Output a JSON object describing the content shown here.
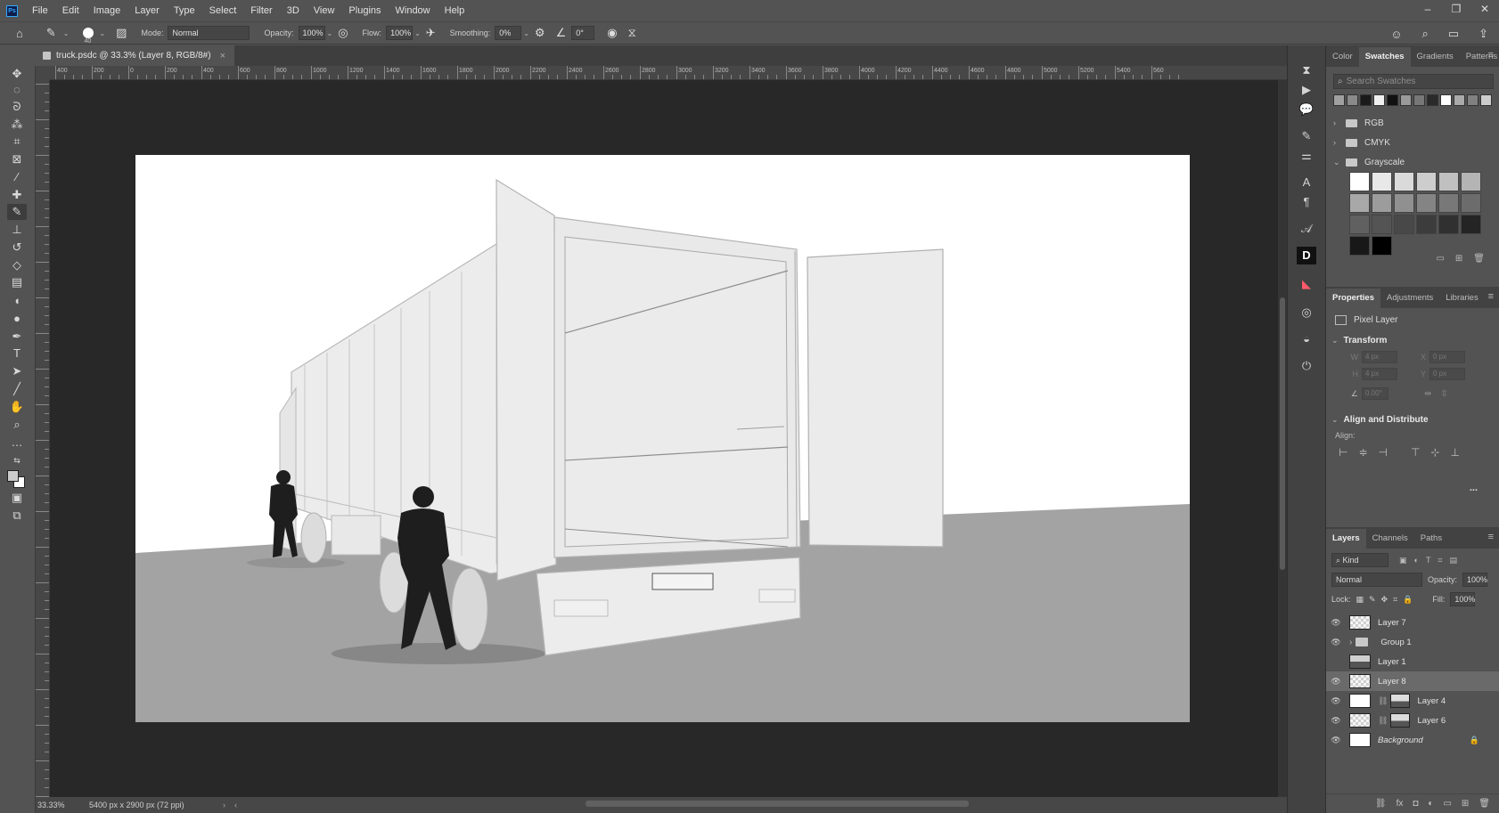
{
  "app": {
    "logo": "Ps"
  },
  "menu": [
    "File",
    "Edit",
    "Image",
    "Layer",
    "Type",
    "Select",
    "Filter",
    "3D",
    "View",
    "Plugins",
    "Window",
    "Help"
  ],
  "window_controls": {
    "minimize": "–",
    "restore": "❐",
    "close": "✕"
  },
  "options_bar": {
    "brush_size": "40",
    "mode_label": "Mode:",
    "mode_value": "Normal",
    "opacity_label": "Opacity:",
    "opacity_value": "100%",
    "flow_label": "Flow:",
    "flow_value": "100%",
    "smoothing_label": "Smoothing:",
    "smoothing_value": "0%",
    "angle_value": "0°"
  },
  "document_tab": {
    "title": "truck.psdc @ 33.3% (Layer 8, RGB/8#)",
    "close": "×"
  },
  "ruler": {
    "h_labels": [
      "400",
      "200",
      "0",
      "200",
      "400",
      "600",
      "800",
      "1000",
      "1200",
      "1400",
      "1600",
      "1800",
      "2000",
      "2200",
      "2400",
      "2600",
      "2800",
      "3000",
      "3200",
      "3400",
      "3600",
      "3800",
      "4000",
      "4200",
      "4400",
      "4600",
      "4800",
      "5000",
      "5200",
      "5400",
      "560"
    ]
  },
  "status_bar": {
    "zoom": "33.33%",
    "doc_info": "5400 px x 2900 px (72 ppi)"
  },
  "swatches_panel": {
    "tabs": [
      "Color",
      "Swatches",
      "Gradients",
      "Patterns"
    ],
    "active_tab": "Swatches",
    "search_placeholder": "Search Swatches",
    "recent_colors": [
      "#a0a0a0",
      "#8a8a8a",
      "#1a1a1a",
      "#f0f0f0",
      "#111111",
      "#9a9a9a",
      "#777777",
      "#2a2a2a",
      "#ffffff",
      "#aaaaaa",
      "#808080",
      "#cccccc"
    ],
    "folders": [
      {
        "name": "RGB",
        "expanded": false
      },
      {
        "name": "CMYK",
        "expanded": false
      },
      {
        "name": "Grayscale",
        "expanded": true
      }
    ],
    "grayscale": [
      "#ffffff",
      "#e8e8e8",
      "#dadada",
      "#cdcdcd",
      "#c0c0c0",
      "#b4b4b4",
      "#a8a8a8",
      "#9c9c9c",
      "#909090",
      "#848484",
      "#787878",
      "#6c6c6c",
      "#606060",
      "#545454",
      "#484848",
      "#3c3c3c",
      "#303030",
      "#242424",
      "#181818",
      "#000000"
    ]
  },
  "properties_panel": {
    "tabs": [
      "Properties",
      "Adjustments",
      "Libraries"
    ],
    "active_tab": "Properties",
    "layer_type": "Pixel Layer",
    "transform_label": "Transform",
    "w_label": "W",
    "w_value": "4 px",
    "x_label": "X",
    "x_value": "0 px",
    "h_label": "H",
    "h_value": "4 px",
    "y_label": "Y",
    "y_value": "0 px",
    "angle_value": "0.00°",
    "align_label": "Align and Distribute",
    "align_sub": "Align:",
    "more": "..."
  },
  "layers_panel": {
    "tabs": [
      "Layers",
      "Channels",
      "Paths"
    ],
    "active_tab": "Layers",
    "filter_label": "Kind",
    "blend_mode": "Normal",
    "opacity_label": "Opacity:",
    "opacity_value": "100%",
    "lock_label": "Lock:",
    "fill_label": "Fill:",
    "fill_value": "100%",
    "layers": [
      {
        "name": "Layer 7",
        "visible": true,
        "thumb": "checker"
      },
      {
        "name": "Group 1",
        "visible": true,
        "thumb": "folder"
      },
      {
        "name": "Layer 1",
        "visible": false,
        "thumb": "photo"
      },
      {
        "name": "Layer 8",
        "visible": true,
        "thumb": "checker",
        "selected": true
      },
      {
        "name": "Layer 4",
        "visible": true,
        "thumb": "white",
        "mask": true
      },
      {
        "name": "Layer 6",
        "visible": true,
        "thumb": "checker",
        "mask": true
      },
      {
        "name": "Background",
        "visible": true,
        "thumb": "white",
        "locked": true
      }
    ]
  }
}
